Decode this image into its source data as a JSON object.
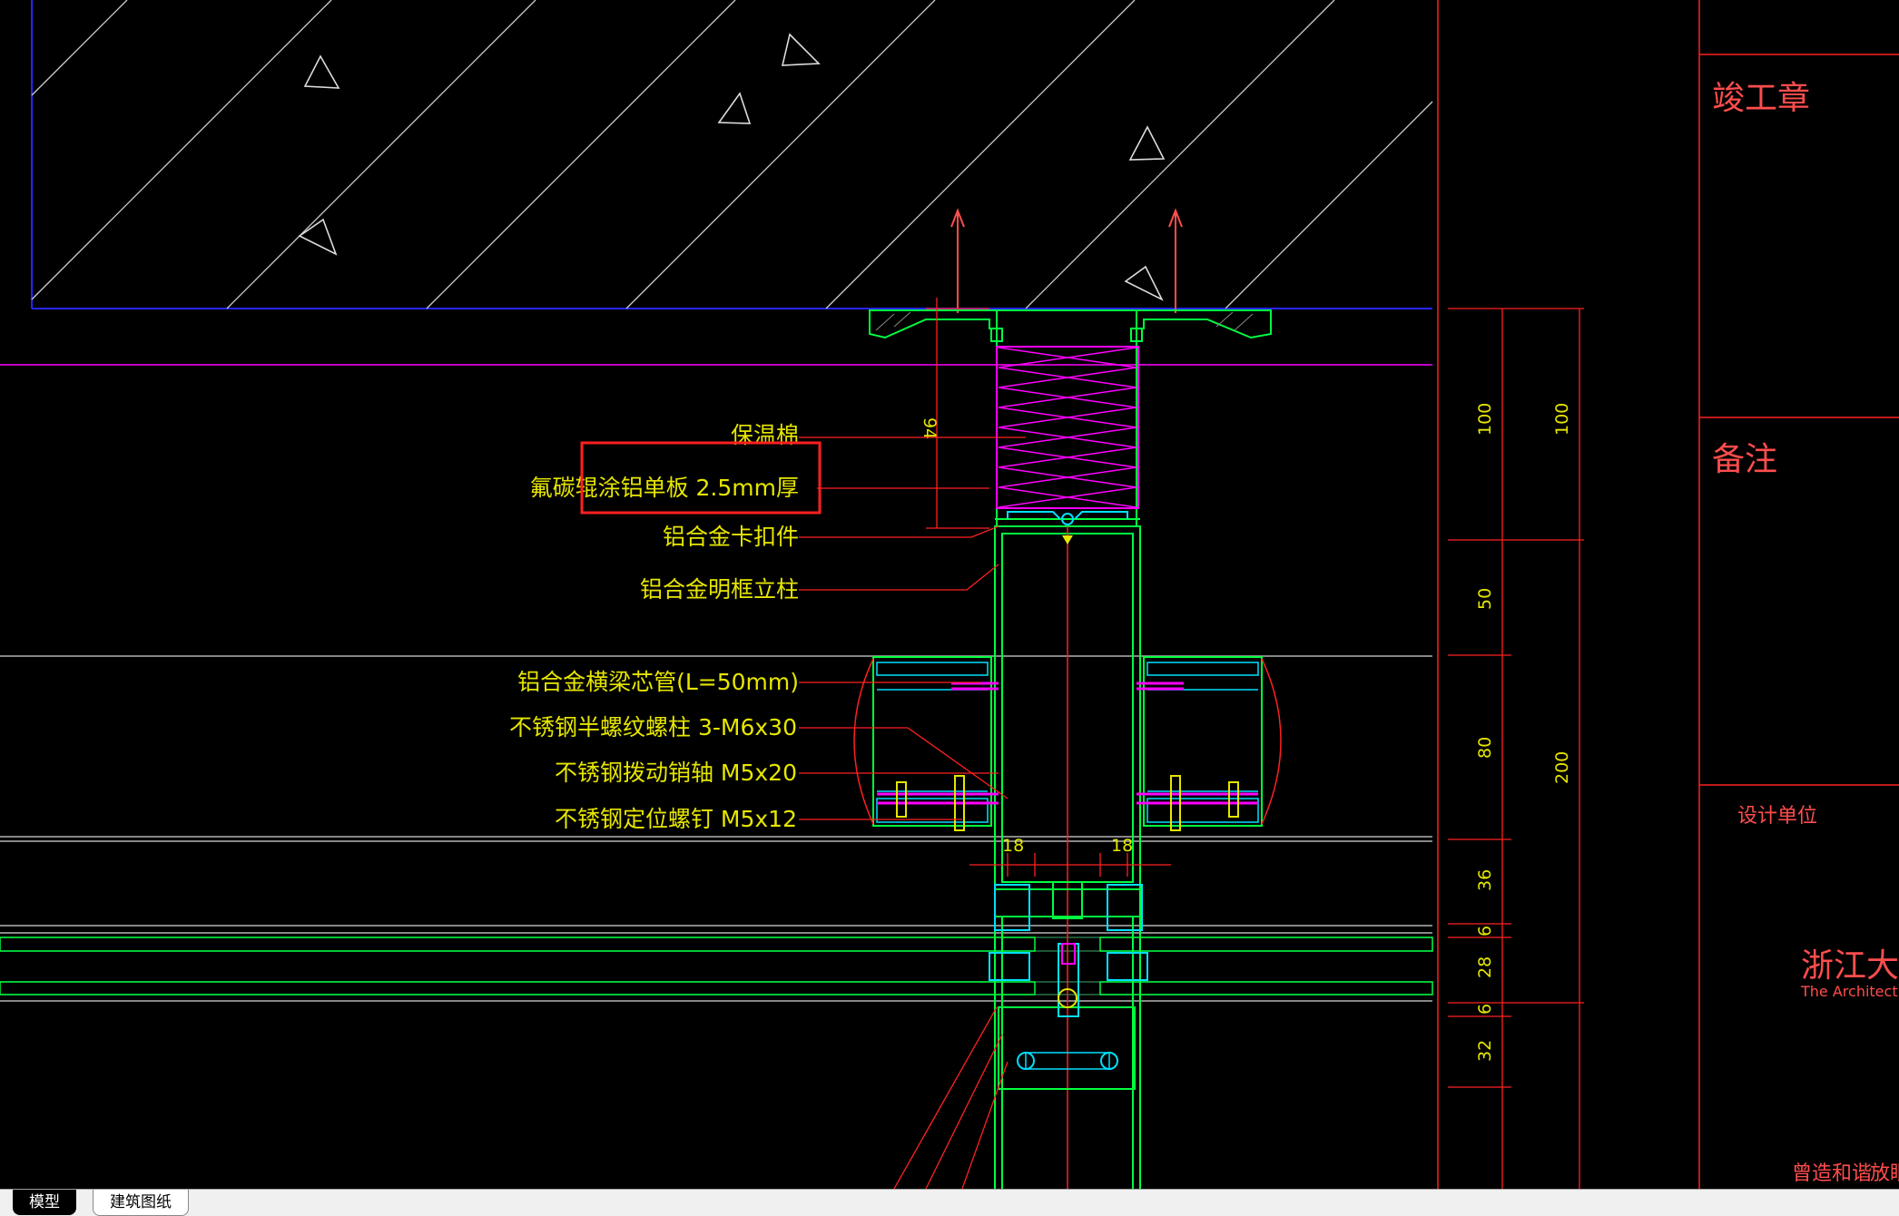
{
  "labels": {
    "insulation": "保温棉",
    "panel": "氟碳辊涂铝单板 2.5mm厚",
    "clip": "铝合金卡扣件",
    "mullion": "铝合金明框立柱",
    "transom_sleeve": "铝合金横梁芯管(L=50mm)",
    "bolt": "不锈钢半螺纹螺柱 3-M6x30",
    "pin": "不锈钢拨动销轴 M5x20",
    "screw": "不锈钢定位螺钉 M5x12"
  },
  "dimensions": {
    "d94": "94",
    "d18a": "18",
    "d18b": "18",
    "left_chain": [
      "100",
      "50",
      "80",
      "36",
      "6",
      "28",
      "6",
      "32"
    ],
    "right_chain": [
      "100",
      "200"
    ]
  },
  "title_block": {
    "stamp": "竣工章",
    "remarks": "备注",
    "design_unit": "设计单位",
    "company_cn": "浙江大",
    "company_en": "The Architectura",
    "footer_a": "曾造和谐",
    "footer_b": "放眼"
  },
  "tabs": {
    "model": "模型",
    "sheet": "建筑图纸"
  },
  "colors": {
    "background": "#000000",
    "wall_border": "#2626ff",
    "hatch": "#d0d0d0",
    "profile": "#00ff40",
    "insulation": "#ff00ff",
    "dimension": "#ff2020",
    "text": "#e6e600",
    "highlight": "#ff2020",
    "cyan": "#00e0ff"
  }
}
